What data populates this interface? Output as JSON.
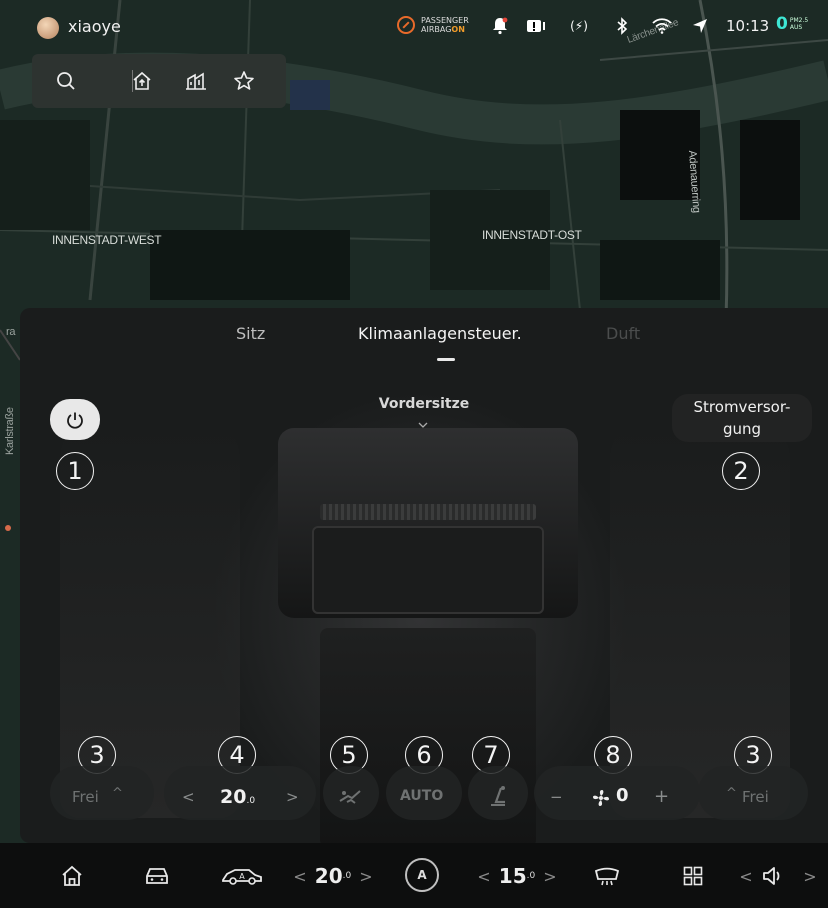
{
  "status": {
    "username": "xiaoye",
    "airbag_line1": "PASSENGER",
    "airbag_line2": "AIRBAG",
    "airbag_state": "ON",
    "time": "10:13",
    "pm_value": "0",
    "pm_label1": "PM2.5",
    "pm_label2": "AUS",
    "icons": [
      "bell-icon",
      "alert-icon",
      "signal-icon",
      "bluetooth-icon",
      "wifi-icon",
      "navigation-arrow-icon"
    ]
  },
  "map": {
    "labels": {
      "west": "INNENSTADT-WEST",
      "ost": "INNENSTADT-OST",
      "adenauerring": "Adenauerring",
      "larch": "Lärchenallee",
      "karlstrasse": "Karlstraße",
      "a": "ra"
    }
  },
  "toolbar": {
    "icons": [
      "search-icon",
      "home-icon",
      "building-icon",
      "star-icon"
    ]
  },
  "climate": {
    "tabs": [
      {
        "label": "Sitz",
        "state": "inactive"
      },
      {
        "label": "Klimaanlagensteuer.",
        "state": "active"
      },
      {
        "label": "Duft",
        "state": "disabled"
      }
    ],
    "front_seats": "Vordersitze",
    "power_supply": "Stromversor-\ngung",
    "annotations": [
      "1",
      "2",
      "3",
      "4",
      "5",
      "6",
      "7",
      "8",
      "3"
    ],
    "left_seat": "Frei",
    "right_seat": "Frei",
    "temp_main": "20",
    "temp_sub": ".0",
    "auto_label": "AUTO",
    "fan_value": "0",
    "fan_minus": "−",
    "fan_plus": "+"
  },
  "bottombar": {
    "temp_left": "20",
    "temp_left_sub": ".0",
    "temp_right": "15",
    "temp_right_sub": ".0",
    "auto_label": "A"
  }
}
